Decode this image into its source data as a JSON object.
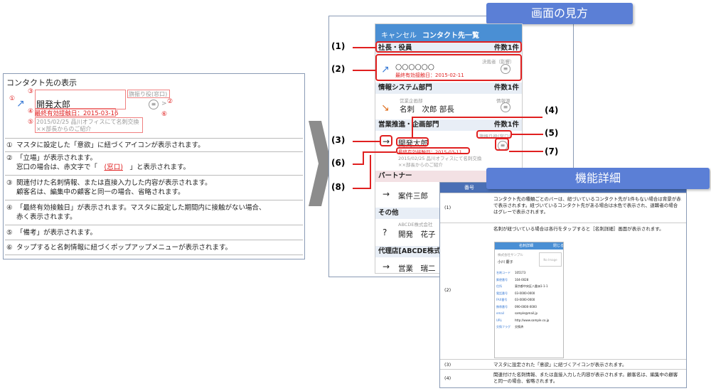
{
  "left": {
    "title": "コンタクト先の表示",
    "sample": {
      "name": "開発太郎",
      "position": "旗振り役(窓口)",
      "last_date": "最終有効接触日：2015-03-16",
      "note1": "2015/02/25 品川オフィスにて名刺交換",
      "note2": "××部長からのご紹介",
      "markers": [
        "①",
        "②",
        "③",
        "④",
        "⑤",
        "⑥"
      ]
    },
    "rows": [
      {
        "num": "①",
        "lines": [
          "マスタに設定した「意欲」に紐づくアイコンが表示されます。"
        ]
      },
      {
        "num": "②",
        "lines": [
          "「立場」が表示されます。",
          "窓口の場合は、赤文字で「　(窓口)　」と表示されます。"
        ]
      },
      {
        "num": "③",
        "lines": [
          "関連付けた名刺情報、または直接入力した内容が表示されます。",
          "顧客名は、編集中の顧客と同一の場合、省略されます。"
        ]
      },
      {
        "num": "④",
        "lines": [
          "「最終有効接触日」が表示されます。マスタに設定した期間内に接触がない場合、",
          "赤く表示されます。"
        ]
      },
      {
        "num": "⑤",
        "lines": [
          "「備考」が表示されます。"
        ]
      },
      {
        "num": "⑥",
        "lines": [
          "タップすると名刺情報に紐づくポップアップメニューが表示されます。"
        ]
      }
    ]
  },
  "screen": {
    "header": "画面の見方",
    "topbar": {
      "cancel": "キャンセル",
      "title": "コンタクト先一覧"
    },
    "sections": [
      {
        "name": "社長・役員",
        "count": "件数1件"
      },
      {
        "name": "情報システム部門",
        "count": "件数1件"
      },
      {
        "name": "営業推進・企画部門",
        "count": "件数1件"
      },
      {
        "name": "パートナー",
        "count": ""
      },
      {
        "name": "その他",
        "count": ""
      },
      {
        "name": "代理店[ABCDE株式",
        "count": ""
      }
    ],
    "entries": {
      "e1_name": "○○○○○○",
      "e1_date": "最終有効接触日：2015-02-11",
      "e1_role": "決裁者（影響）",
      "e2_sub": "営業企画部",
      "e2_name": "名刺　次郎 部長",
      "e2_role": "情報源",
      "e3_name": "開発太郎",
      "e3_role": "旗振り役(窓口)",
      "e3_date": "最終有効接触日：2015-03-11",
      "e3_note1": "2015/02/25 品川オフィスにて名刺交換",
      "e3_note2": "××部長からのご紹介",
      "e4_name": "案件三郎",
      "e5_sub": "ABCDE株式会社",
      "e5_name": "開発　花子",
      "e6_name": "営業　瑞二"
    },
    "labels": [
      "(1)",
      "(2)",
      "(3)",
      "(4)",
      "(5)",
      "(6)",
      "(7)",
      "(8)"
    ]
  },
  "detail": {
    "header": "機能詳細",
    "col_header": "番号",
    "rows": [
      {
        "num": "(1)",
        "text": "コンタクト先の種類ごとのバーは、紐づいているコンタクト先が1件もない場合は背景が赤で表示されます。紐づいているコンタクト先がある場合は水色で表示され、退職者の場合はグレーで表示されます。"
      },
      {
        "num": "(2)",
        "text": "名刺が紐づいている場合は各行をタップすると［名刺詳細］画面が表示されます。"
      },
      {
        "num": "(3)",
        "text": "マスタに設定された「意欲」に紐づくアイコンが表示されます。"
      },
      {
        "num": "(4)",
        "text": "関連付けた名刺情報、または直接入力した内容が表示されます。顧客名は、編集中の顧客と同一の場合、省略されます。"
      }
    ],
    "card": {
      "title": "名刺詳細",
      "close": "閉じる",
      "company": "株式会社サンプル",
      "person": "小川 慶子",
      "no_image": "No Image",
      "fields": [
        "名刺コード",
        "郵便番号",
        "住所",
        "電話番号",
        "FAX番号",
        "携帯番号",
        "email",
        "URL",
        "交換フラグ"
      ],
      "values": [
        "105173",
        "104-0028",
        "東京都中央区八重洲1-1-1",
        "03-0000-0000",
        "03-0000-0000",
        "090-0000-0000",
        "sample@mail.jp",
        "http://www.sample.co.jp",
        "交換済"
      ]
    }
  },
  "colors": {
    "accent": "#5b7fd6",
    "red": "#e02020",
    "bar": "#4a8fd4"
  }
}
